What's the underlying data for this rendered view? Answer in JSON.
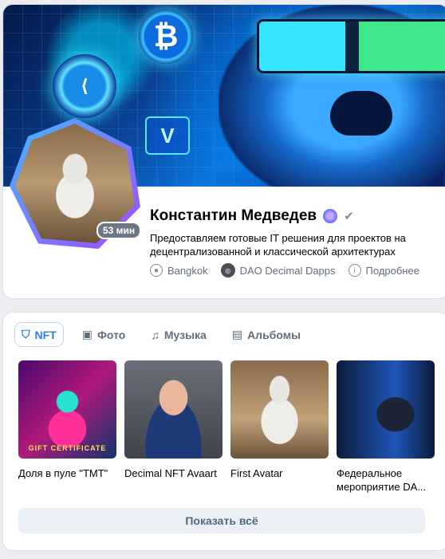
{
  "profile": {
    "name": "Константин Медведев",
    "online_badge": "53 мин",
    "status": "Предоставляем готовые IT решения для проектов на децентрализованной и классической архитектурах",
    "location": "Bangkok",
    "organization": "DAO Decimal Dapps",
    "more": "Подробнее",
    "verified_icon": "check-icon",
    "emoji_icon": "crystal-flame-icon"
  },
  "tabs": [
    {
      "label": "NFT",
      "icon": "nft-shield-icon",
      "active": true
    },
    {
      "label": "Фото",
      "icon": "photo-icon",
      "active": false
    },
    {
      "label": "Музыка",
      "icon": "music-note-icon",
      "active": false
    },
    {
      "label": "Альбомы",
      "icon": "albums-icon",
      "active": false
    }
  ],
  "items": [
    {
      "caption": "Доля в пуле \"TMT\"",
      "thumb_text": "GIFT CERTIFICATE"
    },
    {
      "caption": "Decimal NFT Avaart"
    },
    {
      "caption": "First Avatar"
    },
    {
      "caption": "Федеральное мероприятие DA..."
    }
  ],
  "show_all": "Показать всё",
  "colors": {
    "accent": "#2d81e0",
    "secondary_text": "#626d7a",
    "background": "#ebedf0"
  }
}
